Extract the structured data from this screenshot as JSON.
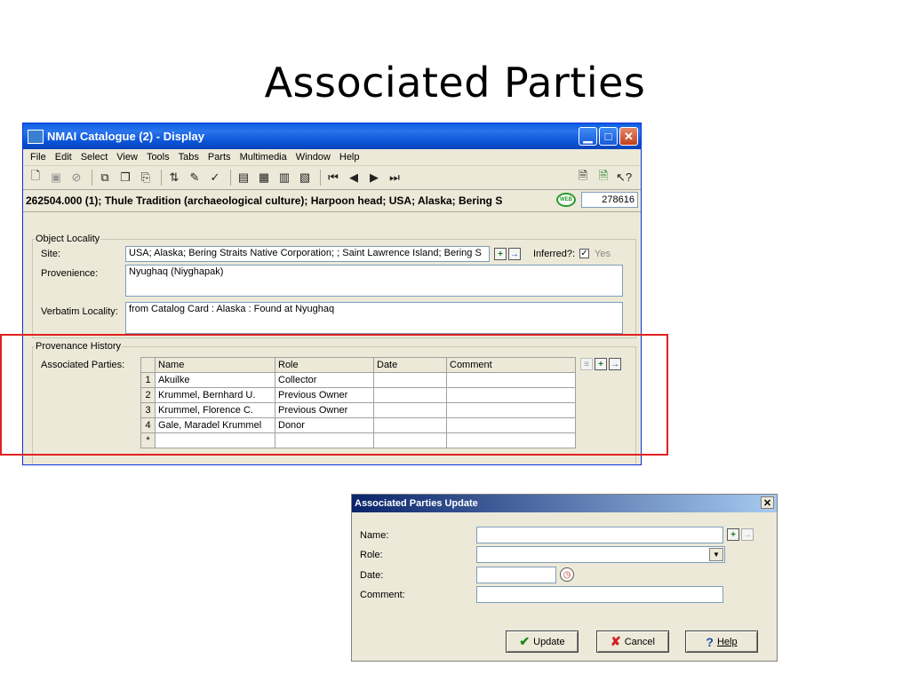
{
  "slide": {
    "title": "Associated Parties"
  },
  "window": {
    "title": "NMAI Catalogue (2) - Display",
    "menu": [
      "File",
      "Edit",
      "Select",
      "View",
      "Tools",
      "Tabs",
      "Parts",
      "Multimedia",
      "Window",
      "Help"
    ],
    "toolbar_icons": [
      "new-icon",
      "save-icon",
      "stop-icon",
      "copy-record-icon",
      "duplicate-icon",
      "clear-icon",
      "sort-icon",
      "edit-icon",
      "spellcheck-icon",
      "view-form-icon",
      "view-table-icon",
      "view-page-icon",
      "view-image-icon",
      "first-record-icon",
      "prev-record-icon",
      "next-record-icon",
      "last-record-icon",
      "report-icon",
      "report2-icon",
      "context-help-icon"
    ],
    "record_title": "262504.000 (1); Thule Tradition (archaeological culture); Harpoon head; USA; Alaska; Bering S",
    "web_badge": "WEB",
    "record_number": "278616"
  },
  "locality": {
    "legend": "Object Locality",
    "site_label": "Site:",
    "site_value": "USA; Alaska; Bering Straits Native Corporation; ; Saint Lawrence Island; Bering S",
    "inferred_label": "Inferred?:",
    "inferred_checked": true,
    "inferred_value": "Yes",
    "provenience_label": "Provenience:",
    "provenience_value": "Nyughaq (Niyghapak)",
    "verbatim_label": "Verbatim Locality:",
    "verbatim_value": "from Catalog Card : Alaska : Found at Nyughaq"
  },
  "provenance": {
    "legend": "Provenance History",
    "parties_label": "Associated Parties:",
    "columns": [
      "Name",
      "Role",
      "Date",
      "Comment"
    ],
    "rows": [
      {
        "num": "1",
        "name": "Akuilke",
        "role": "Collector",
        "date": "",
        "comment": ""
      },
      {
        "num": "2",
        "name": "Krummel, Bernhard U.",
        "role": "Previous Owner",
        "date": "",
        "comment": ""
      },
      {
        "num": "3",
        "name": "Krummel, Florence C.",
        "role": "Previous Owner",
        "date": "",
        "comment": ""
      },
      {
        "num": "4",
        "name": "Gale, Maradel Krummel",
        "role": "Donor",
        "date": "",
        "comment": ""
      }
    ],
    "new_row_marker": "*"
  },
  "dialog": {
    "title": "Associated Parties Update",
    "name_label": "Name:",
    "name_value": "",
    "role_label": "Role:",
    "role_value": "",
    "date_label": "Date:",
    "date_value": "",
    "comment_label": "Comment:",
    "comment_value": "",
    "update_button": "Update",
    "cancel_button": "Cancel",
    "help_button": "Help"
  }
}
